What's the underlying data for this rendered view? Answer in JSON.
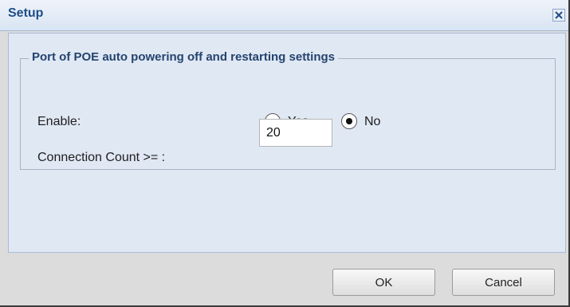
{
  "dialog": {
    "title": "Setup",
    "close_icon": "close-icon"
  },
  "section": {
    "legend": "Port of POE auto powering off and restarting settings",
    "enable": {
      "label": "Enable:",
      "options": [
        {
          "label": "Yes",
          "selected": false
        },
        {
          "label": "No",
          "selected": true
        }
      ]
    },
    "connection_count": {
      "label": "Connection Count >= :",
      "value": "20"
    }
  },
  "buttons": {
    "ok": "OK",
    "cancel": "Cancel"
  },
  "colors": {
    "title_text": "#1f4d87",
    "panel_bg": "#e0e8f4",
    "footer_bg": "#dcdcdc"
  }
}
